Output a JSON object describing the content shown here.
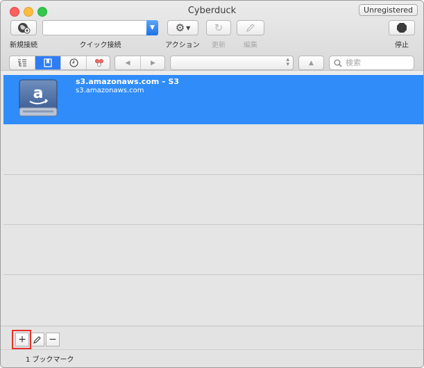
{
  "window": {
    "title": "Cyberduck",
    "unregistered_label": "Unregistered"
  },
  "toolbar": {
    "new_connection": "新規接続",
    "quick_connect": "クイック接続",
    "quick_connect_value": "",
    "action": "アクション",
    "refresh": "更新",
    "edit": "編集",
    "stop": "停止"
  },
  "nav": {
    "view_tabs": [
      "browser-list-icon",
      "bookmark-icon",
      "history-icon",
      "bonjour-icon"
    ],
    "selected_tab": 1,
    "back": "◀",
    "forward": "▶",
    "path_value": "",
    "up": "▲",
    "search_placeholder": "検索"
  },
  "bookmarks": [
    {
      "title": "s3.amazonaws.com – S3",
      "host": "s3.amazonaws.com",
      "icon": "amazon-s3-drive-icon",
      "selected": true
    }
  ],
  "footer": {
    "add": "+",
    "edit_icon": "pencil-icon",
    "remove": "−",
    "status": "1 ブックマーク"
  },
  "colors": {
    "selection": "#2f8cf8",
    "highlight_box": "#e5302a"
  }
}
